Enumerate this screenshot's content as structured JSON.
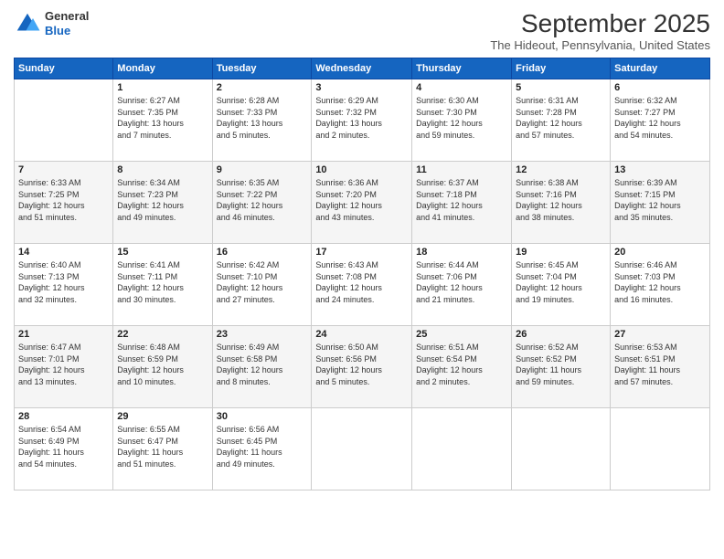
{
  "header": {
    "logo": {
      "general": "General",
      "blue": "Blue"
    },
    "title": "September 2025",
    "location": "The Hideout, Pennsylvania, United States"
  },
  "days_of_week": [
    "Sunday",
    "Monday",
    "Tuesday",
    "Wednesday",
    "Thursday",
    "Friday",
    "Saturday"
  ],
  "weeks": [
    [
      {
        "day": "",
        "info": ""
      },
      {
        "day": "1",
        "info": "Sunrise: 6:27 AM\nSunset: 7:35 PM\nDaylight: 13 hours\nand 7 minutes."
      },
      {
        "day": "2",
        "info": "Sunrise: 6:28 AM\nSunset: 7:33 PM\nDaylight: 13 hours\nand 5 minutes."
      },
      {
        "day": "3",
        "info": "Sunrise: 6:29 AM\nSunset: 7:32 PM\nDaylight: 13 hours\nand 2 minutes."
      },
      {
        "day": "4",
        "info": "Sunrise: 6:30 AM\nSunset: 7:30 PM\nDaylight: 12 hours\nand 59 minutes."
      },
      {
        "day": "5",
        "info": "Sunrise: 6:31 AM\nSunset: 7:28 PM\nDaylight: 12 hours\nand 57 minutes."
      },
      {
        "day": "6",
        "info": "Sunrise: 6:32 AM\nSunset: 7:27 PM\nDaylight: 12 hours\nand 54 minutes."
      }
    ],
    [
      {
        "day": "7",
        "info": "Sunrise: 6:33 AM\nSunset: 7:25 PM\nDaylight: 12 hours\nand 51 minutes."
      },
      {
        "day": "8",
        "info": "Sunrise: 6:34 AM\nSunset: 7:23 PM\nDaylight: 12 hours\nand 49 minutes."
      },
      {
        "day": "9",
        "info": "Sunrise: 6:35 AM\nSunset: 7:22 PM\nDaylight: 12 hours\nand 46 minutes."
      },
      {
        "day": "10",
        "info": "Sunrise: 6:36 AM\nSunset: 7:20 PM\nDaylight: 12 hours\nand 43 minutes."
      },
      {
        "day": "11",
        "info": "Sunrise: 6:37 AM\nSunset: 7:18 PM\nDaylight: 12 hours\nand 41 minutes."
      },
      {
        "day": "12",
        "info": "Sunrise: 6:38 AM\nSunset: 7:16 PM\nDaylight: 12 hours\nand 38 minutes."
      },
      {
        "day": "13",
        "info": "Sunrise: 6:39 AM\nSunset: 7:15 PM\nDaylight: 12 hours\nand 35 minutes."
      }
    ],
    [
      {
        "day": "14",
        "info": "Sunrise: 6:40 AM\nSunset: 7:13 PM\nDaylight: 12 hours\nand 32 minutes."
      },
      {
        "day": "15",
        "info": "Sunrise: 6:41 AM\nSunset: 7:11 PM\nDaylight: 12 hours\nand 30 minutes."
      },
      {
        "day": "16",
        "info": "Sunrise: 6:42 AM\nSunset: 7:10 PM\nDaylight: 12 hours\nand 27 minutes."
      },
      {
        "day": "17",
        "info": "Sunrise: 6:43 AM\nSunset: 7:08 PM\nDaylight: 12 hours\nand 24 minutes."
      },
      {
        "day": "18",
        "info": "Sunrise: 6:44 AM\nSunset: 7:06 PM\nDaylight: 12 hours\nand 21 minutes."
      },
      {
        "day": "19",
        "info": "Sunrise: 6:45 AM\nSunset: 7:04 PM\nDaylight: 12 hours\nand 19 minutes."
      },
      {
        "day": "20",
        "info": "Sunrise: 6:46 AM\nSunset: 7:03 PM\nDaylight: 12 hours\nand 16 minutes."
      }
    ],
    [
      {
        "day": "21",
        "info": "Sunrise: 6:47 AM\nSunset: 7:01 PM\nDaylight: 12 hours\nand 13 minutes."
      },
      {
        "day": "22",
        "info": "Sunrise: 6:48 AM\nSunset: 6:59 PM\nDaylight: 12 hours\nand 10 minutes."
      },
      {
        "day": "23",
        "info": "Sunrise: 6:49 AM\nSunset: 6:58 PM\nDaylight: 12 hours\nand 8 minutes."
      },
      {
        "day": "24",
        "info": "Sunrise: 6:50 AM\nSunset: 6:56 PM\nDaylight: 12 hours\nand 5 minutes."
      },
      {
        "day": "25",
        "info": "Sunrise: 6:51 AM\nSunset: 6:54 PM\nDaylight: 12 hours\nand 2 minutes."
      },
      {
        "day": "26",
        "info": "Sunrise: 6:52 AM\nSunset: 6:52 PM\nDaylight: 11 hours\nand 59 minutes."
      },
      {
        "day": "27",
        "info": "Sunrise: 6:53 AM\nSunset: 6:51 PM\nDaylight: 11 hours\nand 57 minutes."
      }
    ],
    [
      {
        "day": "28",
        "info": "Sunrise: 6:54 AM\nSunset: 6:49 PM\nDaylight: 11 hours\nand 54 minutes."
      },
      {
        "day": "29",
        "info": "Sunrise: 6:55 AM\nSunset: 6:47 PM\nDaylight: 11 hours\nand 51 minutes."
      },
      {
        "day": "30",
        "info": "Sunrise: 6:56 AM\nSunset: 6:45 PM\nDaylight: 11 hours\nand 49 minutes."
      },
      {
        "day": "",
        "info": ""
      },
      {
        "day": "",
        "info": ""
      },
      {
        "day": "",
        "info": ""
      },
      {
        "day": "",
        "info": ""
      }
    ]
  ]
}
